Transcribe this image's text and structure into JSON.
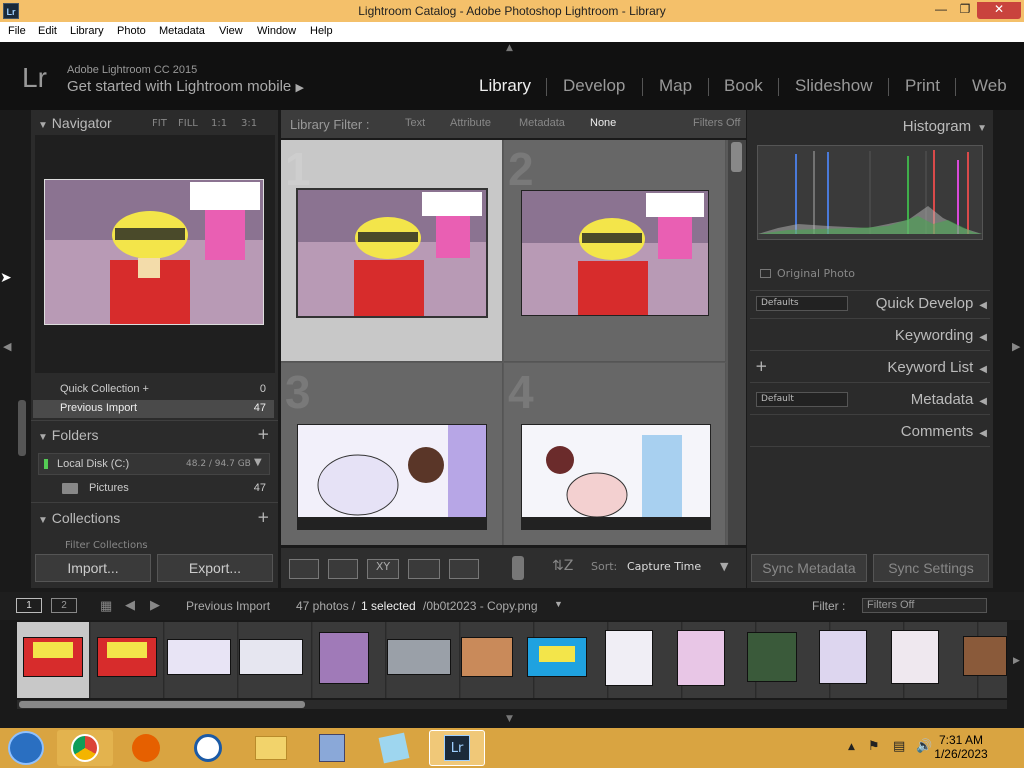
{
  "window": {
    "title": "Lightroom Catalog - Adobe Photoshop Lightroom - Library",
    "app_icon": "Lr"
  },
  "menu": [
    "File",
    "Edit",
    "Library",
    "Photo",
    "Metadata",
    "View",
    "Window",
    "Help"
  ],
  "identity": {
    "logo": "Lr",
    "version": "Adobe Lightroom CC 2015",
    "mobile": "Get started with Lightroom mobile"
  },
  "modules": [
    "Library",
    "Develop",
    "Map",
    "Book",
    "Slideshow",
    "Print",
    "Web"
  ],
  "active_module": "Library",
  "navigator": {
    "title": "Navigator",
    "zoom": [
      "FIT",
      "FILL",
      "1:1",
      "3:1"
    ]
  },
  "catalog": {
    "quick_collection": {
      "label": "Quick Collection +",
      "count": "0"
    },
    "previous_import": {
      "label": "Previous Import",
      "count": "47"
    }
  },
  "folders": {
    "title": "Folders",
    "disk": {
      "label": "Local Disk (C:)",
      "size": "48.2 / 94.7 GB"
    },
    "items": [
      {
        "label": "Pictures",
        "count": "47"
      }
    ]
  },
  "collections": {
    "title": "Collections",
    "partial": "Filter Collections"
  },
  "buttons": {
    "import": "Import...",
    "export": "Export...",
    "sync_metadata": "Sync Metadata",
    "sync_settings": "Sync Settings"
  },
  "filter_bar": {
    "label": "Library Filter :",
    "options": [
      "Text",
      "Attribute",
      "Metadata",
      "None"
    ],
    "status": "Filters Off"
  },
  "grid": {
    "cells": [
      "1",
      "2",
      "3",
      "4"
    ]
  },
  "toolbar": {
    "sort_label": "Sort:",
    "sort_value": "Capture Time"
  },
  "right_panel": {
    "histogram": "Histogram",
    "original_photo": "Original Photo",
    "quick_develop": "Quick Develop",
    "quick_develop_preset": "Defaults",
    "keywording": "Keywording",
    "keyword_list": "Keyword List",
    "metadata": "Metadata",
    "metadata_preset": "Default",
    "comments": "Comments"
  },
  "filmstrip": {
    "page1": "1",
    "page2": "2",
    "source": "Previous Import",
    "count_text": "47 photos /",
    "selected_text": "1 selected",
    "filename": "/0b0t2023 - Copy.png",
    "filter_label": "Filter :",
    "filter_value": "Filters Off"
  },
  "taskbar": {
    "time": "7:31 AM",
    "date": "1/26/2023"
  },
  "colors": {
    "accent": "#f4c06a",
    "panel": "#2b2b2b",
    "taskbar": "#d9a441"
  }
}
